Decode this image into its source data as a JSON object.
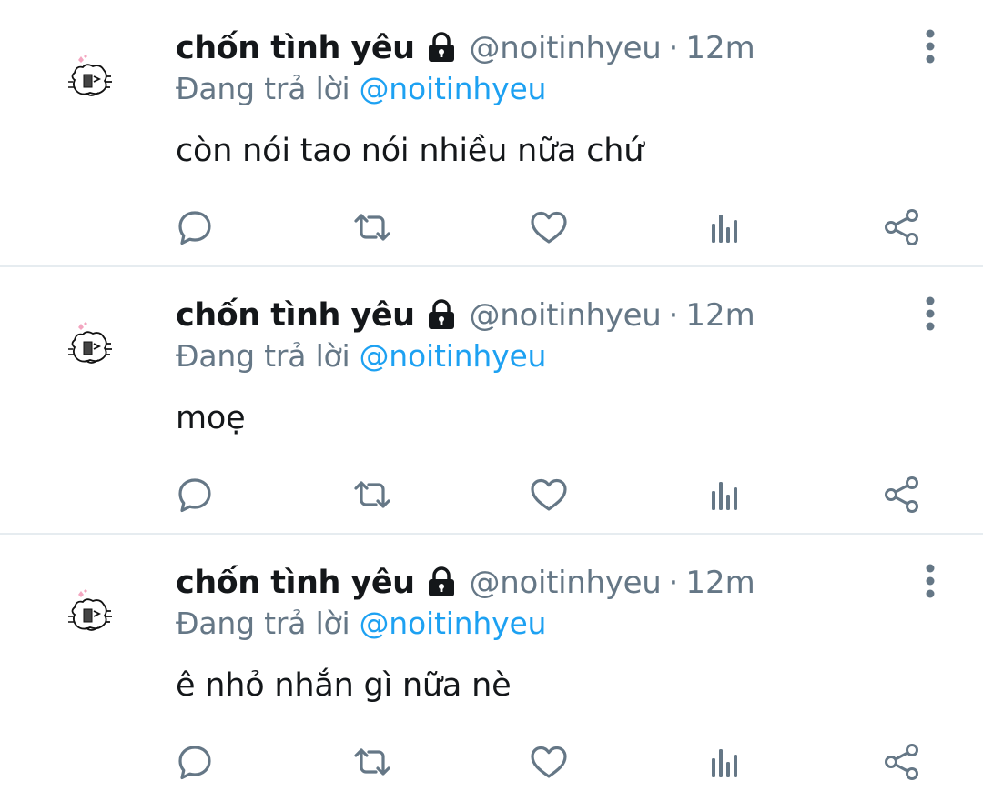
{
  "colors": {
    "text": "#14171a",
    "secondary": "#657786",
    "accent": "#1da1f2",
    "icon": "#657786",
    "divider": "#e6ecf0"
  },
  "tweets": [
    {
      "display_name": "chốn tình yêu",
      "handle": "@noitinhyeu",
      "separator": "·",
      "time": "12m",
      "reply_prefix": "Đang trả lời",
      "reply_to": "@noitinhyeu",
      "text": "còn nói tao nói nhiều nữa chứ",
      "protected_icon": "lock-icon",
      "more_icon": "more-vertical-icon"
    },
    {
      "display_name": "chốn tình yêu",
      "handle": "@noitinhyeu",
      "separator": "·",
      "time": "12m",
      "reply_prefix": "Đang trả lời",
      "reply_to": "@noitinhyeu",
      "text": "moẹ",
      "protected_icon": "lock-icon",
      "more_icon": "more-vertical-icon"
    },
    {
      "display_name": "chốn tình yêu",
      "handle": "@noitinhyeu",
      "separator": "·",
      "time": "12m",
      "reply_prefix": "Đang trả lời",
      "reply_to": "@noitinhyeu",
      "text": "ê nhỏ nhắn gì nữa nè",
      "protected_icon": "lock-icon",
      "more_icon": "more-vertical-icon"
    }
  ],
  "action_icons": [
    "reply-icon",
    "retweet-icon",
    "like-icon",
    "analytics-icon",
    "share-icon"
  ]
}
